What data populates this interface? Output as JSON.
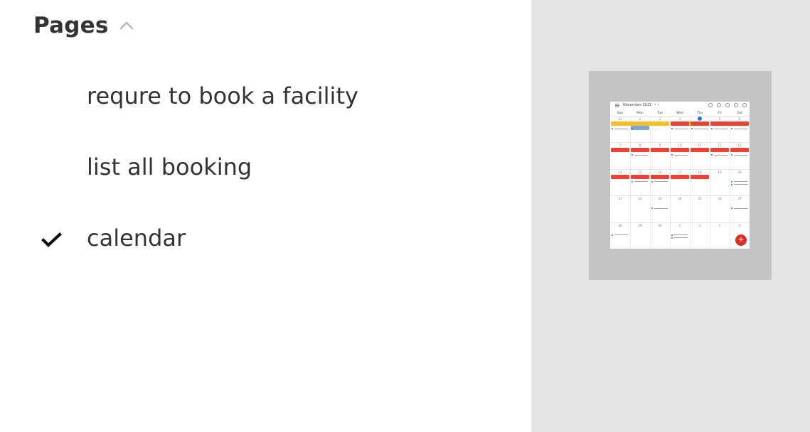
{
  "sidebar": {
    "title": "Pages",
    "collapse_icon": "chevron-up-icon",
    "pages": [
      {
        "label": "requre to book a facility",
        "selected": false
      },
      {
        "label": "list all booking",
        "selected": false
      },
      {
        "label": "calendar",
        "selected": true
      }
    ]
  },
  "preview": {
    "calendar": {
      "month": "November 2021",
      "nav": "‹ ›",
      "weekdays": [
        "Sun",
        "Mon",
        "Tue",
        "Wed",
        "Thu",
        "Fri",
        "Sat"
      ],
      "weeks": [
        [
          "31",
          "1",
          "2",
          "3",
          "4",
          "5",
          "6"
        ],
        [
          "7",
          "8",
          "9",
          "10",
          "11",
          "12",
          "13"
        ],
        [
          "14",
          "15",
          "16",
          "17",
          "18",
          "19",
          "20"
        ],
        [
          "21",
          "22",
          "23",
          "24",
          "25",
          "26",
          "27"
        ],
        [
          "28",
          "29",
          "30",
          "1",
          "2",
          "3",
          "4"
        ]
      ]
    }
  },
  "colors": {
    "red_event": "#ea4335",
    "yellow_event": "#f6bf26",
    "blue_event": "#7ba7e0",
    "panel_bg": "#e5e5e5",
    "frame_bg": "#c4c4c4"
  }
}
